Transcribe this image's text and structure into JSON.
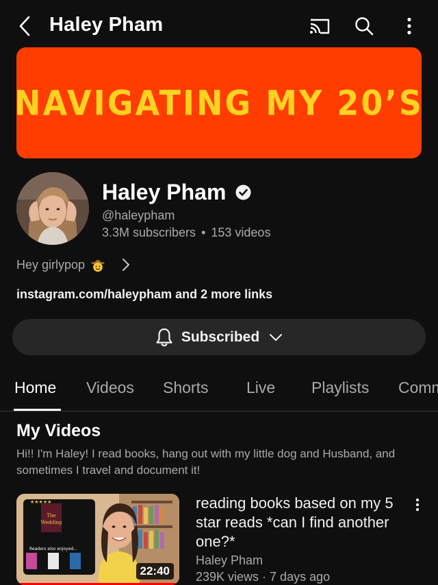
{
  "header": {
    "title": "Haley Pham",
    "icons": [
      "back-arrow-icon",
      "cast-icon",
      "search-icon",
      "more-vertical-icon"
    ]
  },
  "banner": {
    "text": "NAVIGATING MY 20’S",
    "background_color": "#ff3d00",
    "text_color": "#ffd21f"
  },
  "channel": {
    "name": "Haley Pham",
    "verified": true,
    "handle": "@haleypham",
    "subscribers": "3.3M subscribers",
    "separator": "•",
    "videos": "153 videos",
    "tagline": "Hey girlypop",
    "tagline_emoji": "cowboy-face-emoji",
    "links": "instagram.com/haleypham and 2 more links"
  },
  "subscribe": {
    "label": "Subscribed",
    "icon": "bell-icon"
  },
  "tabs": [
    {
      "label": "Home",
      "active": true
    },
    {
      "label": "Videos",
      "active": false
    },
    {
      "label": "Shorts",
      "active": false
    },
    {
      "label": "Live",
      "active": false
    },
    {
      "label": "Playlists",
      "active": false
    },
    {
      "label": "Community",
      "active": false
    }
  ],
  "section": {
    "title": "My Videos",
    "description": "Hi!! I'm Haley! I read books, hang out with my little dog and Husband, and sometimes I travel and document it!"
  },
  "video": {
    "title": "reading books based on my 5 star reads *can I find another one?*",
    "channel": "Haley Pham",
    "meta": "239K views · 7 days ago",
    "duration": "22:40",
    "thumbnail_overlay_text": "Readers also enjoyed..."
  }
}
